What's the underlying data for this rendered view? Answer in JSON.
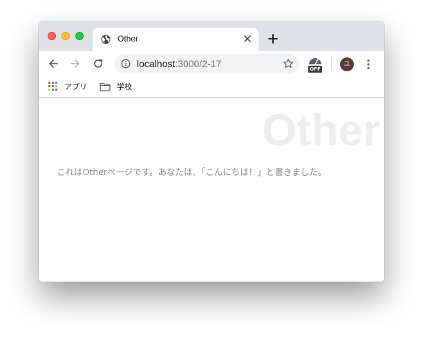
{
  "window": {
    "traffic_lights": {
      "close": "#ff5f57",
      "minimize": "#febc2e",
      "zoom": "#28c840"
    }
  },
  "tab": {
    "title": "Other",
    "favicon": "globe-icon",
    "close_icon": "close-icon"
  },
  "toolbar": {
    "back_icon": "arrow-left-icon",
    "forward_icon": "arrow-right-icon",
    "reload_icon": "reload-icon",
    "url_host": "localhost",
    "url_path": ":3000/2-17",
    "info_icon": "info-icon",
    "bookmark_star_icon": "star-icon",
    "extension_badge": "OFF",
    "avatar_initial": "ユ",
    "avatar_color": "#5b3a31",
    "menu_icon": "kebab-menu-icon"
  },
  "bookmarks": [
    {
      "label": "アプリ",
      "icon": "apps-grid-icon"
    },
    {
      "label": "学校",
      "icon": "folder-icon"
    }
  ],
  "page": {
    "watermark": "Other",
    "message": "これはOtherページです。あなたは、「こんにちは！」と書きました。"
  }
}
